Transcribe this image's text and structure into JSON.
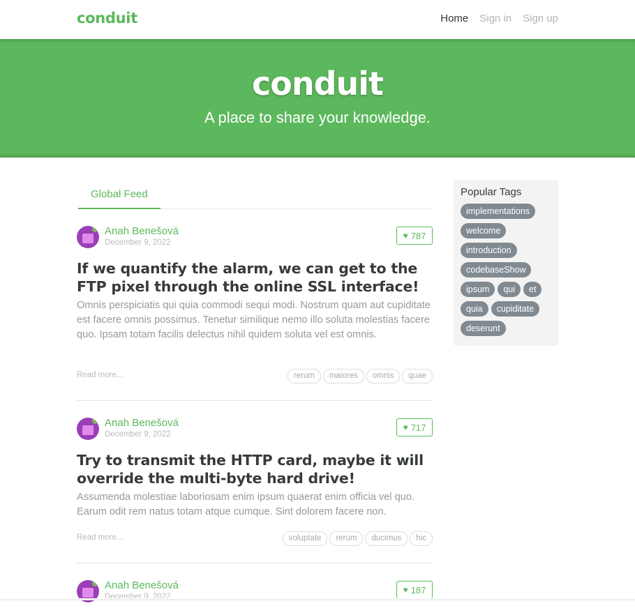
{
  "navbar": {
    "brand": "conduit",
    "links": [
      {
        "label": "Home",
        "active": true
      },
      {
        "label": "Sign in",
        "active": false
      },
      {
        "label": "Sign up",
        "active": false
      }
    ]
  },
  "banner": {
    "title": "conduit",
    "subtitle": "A place to share your knowledge."
  },
  "feed": {
    "tab_label": "Global Feed",
    "articles": [
      {
        "author": "Anah Benešová",
        "date": "December 9, 2022",
        "likes": "787",
        "title": "If we quantify the alarm, we can get to the FTP pixel through the online SSL interface!",
        "description": "Omnis perspiciatis qui quia commodi sequi modi. Nostrum quam aut cupiditate est facere omnis possimus. Tenetur similique nemo illo soluta molestias facere quo. Ipsam totam facilis delectus nihil quidem soluta vel est omnis.",
        "read_more": "Read more...",
        "tags": [
          "rerum",
          "maiores",
          "omnis",
          "quae"
        ]
      },
      {
        "author": "Anah Benešová",
        "date": "December 9, 2022",
        "likes": "717",
        "title": "Try to transmit the HTTP card, maybe it will override the multi-byte hard drive!",
        "description": "Assumenda molestiae laboriosam enim ipsum quaerat enim officia vel quo. Earum odit rem natus totam atque cumque. Sint dolorem facere non.",
        "read_more": "Read more...",
        "tags": [
          "voluptate",
          "rerum",
          "ducimus",
          "hic"
        ]
      },
      {
        "author": "Anah Benešová",
        "date": "December 9, 2022",
        "likes": "187"
      }
    ]
  },
  "sidebar": {
    "title": "Popular Tags",
    "tags": [
      "implementations",
      "welcome",
      "introduction",
      "codebaseShow",
      "ipsum",
      "qui",
      "et",
      "quia",
      "cupiditate",
      "deserunt"
    ]
  },
  "colors": {
    "brand": "#5cb85c",
    "tag_pill": "#818a91",
    "sidebar_bg": "#f3f3f3"
  },
  "icons": {
    "like": "heart-icon",
    "avatar": "user-avatar"
  }
}
